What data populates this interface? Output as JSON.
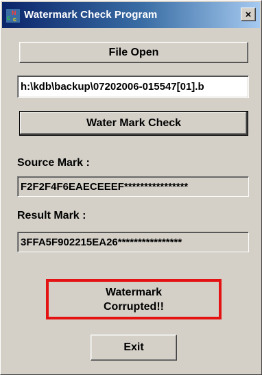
{
  "window": {
    "title": "Watermark Check Program",
    "close_label": "×"
  },
  "buttons": {
    "file_open": "File Open",
    "water_mark_check": "Water Mark Check",
    "exit": "Exit"
  },
  "file_path": "h:\\kdb\\backup\\07202006-015547[01].b",
  "source": {
    "label": "Source Mark :",
    "value": "F2F2F4F6EAECEEEF****************"
  },
  "result": {
    "label": "Result Mark  :",
    "value": "3FFA5F902215EA26****************"
  },
  "status": {
    "line1": "Watermark",
    "line2": "Corrupted!!",
    "border_color": "#e41212"
  },
  "colors": {
    "title_gradient_start": "#0a246a",
    "title_gradient_end": "#a6caf0",
    "face": "#d4d0c8"
  }
}
